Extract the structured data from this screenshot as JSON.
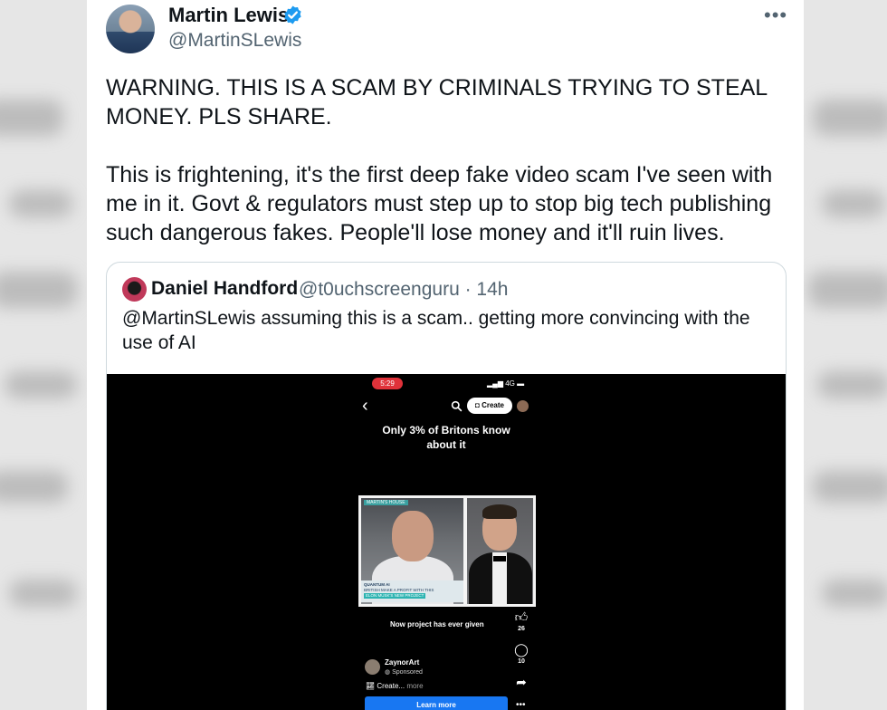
{
  "author": {
    "name": "Martin Lewis",
    "handle": "@MartinSLewis"
  },
  "tweet": {
    "text": "WARNING. THIS IS A SCAM BY CRIMINALS TRYING TO STEAL MONEY. PLS SHARE.\n\nThis is frightening, it's the first deep fake video scam I've seen with me in it. Govt & regulators must step up to stop big tech publishing such dangerous fakes. People'll lose money and it'll ruin lives."
  },
  "quote": {
    "name": "Daniel Handford",
    "handle_time": "@t0uchscreenguru · 14h",
    "text": "@MartinSLewis assuming this is a scam.. getting more convincing with the use of AI"
  },
  "video": {
    "status_time": "5:29",
    "status_network": "4G",
    "create_label": "Create",
    "headline": "Only 3% of Britons know about it",
    "inset": {
      "tag": "MARTIN'S HOUSE",
      "lower_third_title": "QUANTUM AI",
      "lower_third_line1": "BRITISH MAKE A PROFIT WITH THIS",
      "lower_third_line2": "ELON MUSK'S NEW PROJECT"
    },
    "caption": "Now project has ever given",
    "likes": "26",
    "comments": "10",
    "author_name": "ZaynorArt",
    "author_sub": "Sponsored",
    "desc": "Create...",
    "desc_more": "more",
    "cta": "Learn more"
  },
  "colors": {
    "verified": "#1d9bf0",
    "cta": "#1877f2",
    "status_badge": "#e0323a",
    "secondary_text": "#536471"
  }
}
